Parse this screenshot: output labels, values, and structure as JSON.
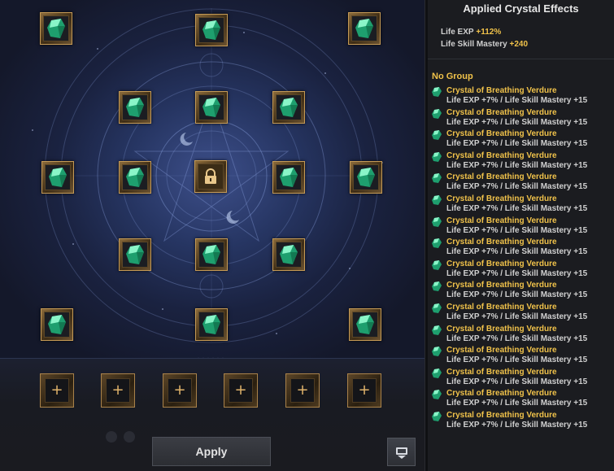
{
  "right_panel": {
    "title": "Applied Crystal Effects",
    "summary": [
      {
        "label": "Life EXP",
        "value": "+112%"
      },
      {
        "label": "Life Skill Mastery",
        "value": "+240"
      }
    ],
    "group_title": "No Group",
    "effects": [
      {
        "name": "Crystal of Breathing Verdure",
        "desc": "Life EXP +7% / Life Skill Mastery +15"
      },
      {
        "name": "Crystal of Breathing Verdure",
        "desc": "Life EXP +7% / Life Skill Mastery +15"
      },
      {
        "name": "Crystal of Breathing Verdure",
        "desc": "Life EXP +7% / Life Skill Mastery +15"
      },
      {
        "name": "Crystal of Breathing Verdure",
        "desc": "Life EXP +7% / Life Skill Mastery +15"
      },
      {
        "name": "Crystal of Breathing Verdure",
        "desc": "Life EXP +7% / Life Skill Mastery +15"
      },
      {
        "name": "Crystal of Breathing Verdure",
        "desc": "Life EXP +7% / Life Skill Mastery +15"
      },
      {
        "name": "Crystal of Breathing Verdure",
        "desc": "Life EXP +7% / Life Skill Mastery +15"
      },
      {
        "name": "Crystal of Breathing Verdure",
        "desc": "Life EXP +7% / Life Skill Mastery +15"
      },
      {
        "name": "Crystal of Breathing Verdure",
        "desc": "Life EXP +7% / Life Skill Mastery +15"
      },
      {
        "name": "Crystal of Breathing Verdure",
        "desc": "Life EXP +7% / Life Skill Mastery +15"
      },
      {
        "name": "Crystal of Breathing Verdure",
        "desc": "Life EXP +7% / Life Skill Mastery +15"
      },
      {
        "name": "Crystal of Breathing Verdure",
        "desc": "Life EXP +7% / Life Skill Mastery +15"
      },
      {
        "name": "Crystal of Breathing Verdure",
        "desc": "Life EXP +7% / Life Skill Mastery +15"
      },
      {
        "name": "Crystal of Breathing Verdure",
        "desc": "Life EXP +7% / Life Skill Mastery +15"
      },
      {
        "name": "Crystal of Breathing Verdure",
        "desc": "Life EXP +7% / Life Skill Mastery +15"
      },
      {
        "name": "Crystal of Breathing Verdure",
        "desc": "Life EXP +7% / Life Skill Mastery +15"
      }
    ]
  },
  "crystal_board": {
    "crystal_icon": "green-crystal-icon",
    "center_icon": "lock-icon",
    "add_slot_icon": "plus-icon",
    "add_slot_label": "+"
  },
  "buttons": {
    "apply_label": "Apply",
    "tray_icon": "tray-icon"
  },
  "colors": {
    "accent_gold": "#f0c24a",
    "crystal_green": "#2fd39a",
    "slot_border": "#c59a55"
  }
}
